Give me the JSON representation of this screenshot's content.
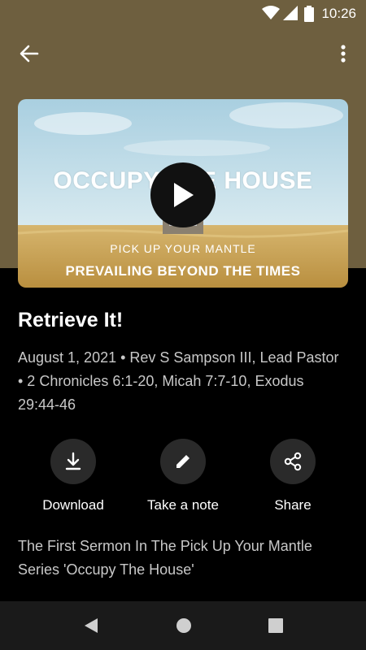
{
  "status": {
    "time": "10:26"
  },
  "toolbar": {
    "back_icon": "arrow-back-icon",
    "menu_icon": "more-vert-icon"
  },
  "video": {
    "title_text": "OCCUPY THE HOUSE",
    "subtitle_text": "PICK UP YOUR MANTLE",
    "tagline_text": "PREVAILING BEYOND THE TIMES",
    "play_icon": "play-icon"
  },
  "sermon": {
    "title": "Retrieve It!",
    "meta": "August 1, 2021 • Rev S Sampson III, Lead Pastor • 2 Chronicles 6:1-20, Micah 7:7-10, Exodus 29:44-46",
    "description": "The First Sermon In The Pick Up Your Mantle Series 'Occupy The House'"
  },
  "actions": [
    {
      "label": "Download",
      "icon": "download-icon"
    },
    {
      "label": "Take a note",
      "icon": "pencil-icon"
    },
    {
      "label": "Share",
      "icon": "share-icon"
    }
  ],
  "colors": {
    "header_band": "#6e5f3f",
    "background": "#000000",
    "action_circle": "#2a2a2a",
    "nav_bar": "#1a1a1a"
  }
}
